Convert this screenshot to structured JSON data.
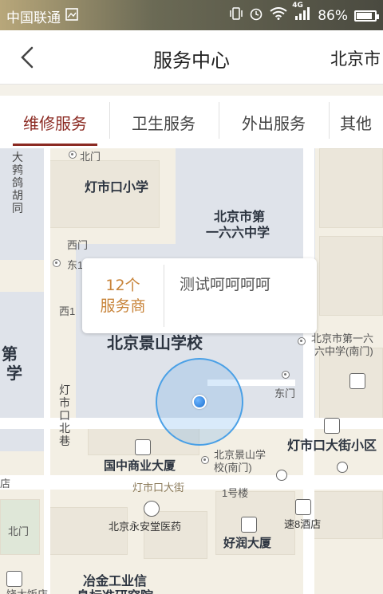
{
  "statusbar": {
    "carrier": "中国联通",
    "network": "4G",
    "battery": "86%",
    "battery_level": 0.86
  },
  "titlebar": {
    "title": "服务中心",
    "city": "北京市"
  },
  "tabs": [
    {
      "label": "维修服务",
      "active": true
    },
    {
      "label": "卫生服务",
      "active": false
    },
    {
      "label": "外出服务",
      "active": false
    },
    {
      "label": "其他",
      "active": false
    }
  ],
  "popup": {
    "count_line1": "12个",
    "count_line2": "服务商",
    "name": "测试呵呵呵呵"
  },
  "map": {
    "labels": {
      "beimen_top": "北门",
      "dengshikou_school": "灯市口小学",
      "beijing_166_line1": "北京市第",
      "beijing_166_line2": "一六六中学",
      "ximen": "西门",
      "dong": "东1",
      "xi1": "西1",
      "jingshan_school": "北京景山学校",
      "beijing_166_south_line1": "北京市第一六",
      "beijing_166_south_line2": "六中学(南门)",
      "dongmen": "东门",
      "dengshikou_xiaoqu": "灯市口大街小区",
      "guozhong": "国中商业大厦",
      "jingshan_south_line1": "北京景山学",
      "jingshan_south_line2": "校(南门)",
      "dian": "店",
      "dengshikou_dajie": "灯市口大街",
      "building1": "1号楼",
      "yonganzhang": "北京永安堂医药",
      "su8": "速8酒店",
      "beimen_bottom": "北门",
      "haorun": "好润大厦",
      "yejin": "冶金工业信",
      "yejin2": "息标准研究院",
      "dajiudian": "饶大饭店",
      "vertical_left": "大鹁鸽胡同",
      "vertical_mid": "灯市口北巷",
      "vertical_big_1": "第",
      "vertical_big_2": "学"
    }
  },
  "colors": {
    "accent": "#8b2a22",
    "popup_count": "#c8843a",
    "location": "#4aa0e6"
  }
}
